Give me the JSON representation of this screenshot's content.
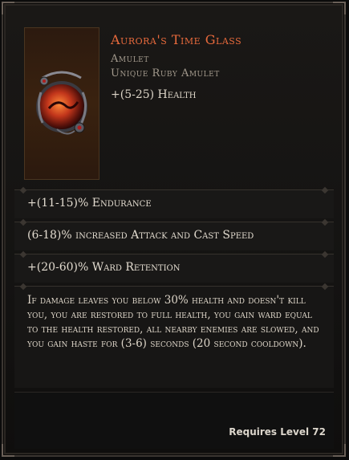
{
  "item": {
    "name": "Aurora's Time Glass",
    "type": "Amulet",
    "base": "Unique Ruby Amulet",
    "implicit": "+(5-25) Health",
    "icon": "amulet-orb-icon"
  },
  "affixes": [
    "+(11-15)% Endurance",
    "(6-18)% increased Attack and Cast Speed",
    "+(20-60)% Ward Retention"
  ],
  "description": "If damage leaves you below 30% health and doesn't kill you, you are restored to full health, you gain ward equal to the health restored, all nearby enemies are slowed, and you gain haste for (3-6) seconds (20 second cooldown).",
  "requirement": "Requires Level 72",
  "colors": {
    "name": "#e86a3c",
    "subtle": "#a39a8d",
    "text": "#e2dbcf",
    "border": "#3b3631"
  }
}
